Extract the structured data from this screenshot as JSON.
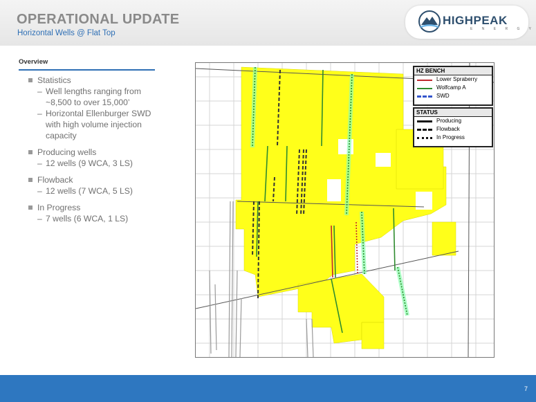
{
  "header": {
    "title": "OPERATIONAL UPDATE",
    "subtitle": "Horizontal Wells @ Flat Top"
  },
  "logo": {
    "main": "HIGHPEAK",
    "sub": "E N E R G Y"
  },
  "overview": {
    "label": "Overview",
    "items": [
      {
        "text": "Statistics",
        "subs": [
          "Well lengths ranging from",
          "~8,500 to over 15,000’",
          "Horizontal Ellenburger SWD",
          "with high volume injection",
          "capacity"
        ]
      },
      {
        "text": "Producing wells",
        "subs": [
          "12 wells (9 WCA, 3 LS)"
        ]
      },
      {
        "text": "Flowback",
        "subs": [
          "12 wells (7 WCA, 5 LS)"
        ]
      },
      {
        "text": "In Progress",
        "subs": [
          "7 wells (6 WCA, 1 LS)"
        ]
      }
    ]
  },
  "legend": {
    "bench_title": "HZ BENCH",
    "bench": [
      {
        "label": "Lower Spraberry",
        "color": "#c0282d"
      },
      {
        "label": "Wolfcamp A",
        "color": "#2e8b2e"
      },
      {
        "label": "SWD",
        "color": "#3355cc"
      }
    ],
    "status_title": "STATUS",
    "status": [
      "Producing",
      "Flowback",
      "In Progress"
    ]
  },
  "colors": {
    "acreage": "#ffff1a",
    "accent": "#2e6fb5",
    "footer": "#2e77c0"
  },
  "footer": {
    "page": "7"
  }
}
